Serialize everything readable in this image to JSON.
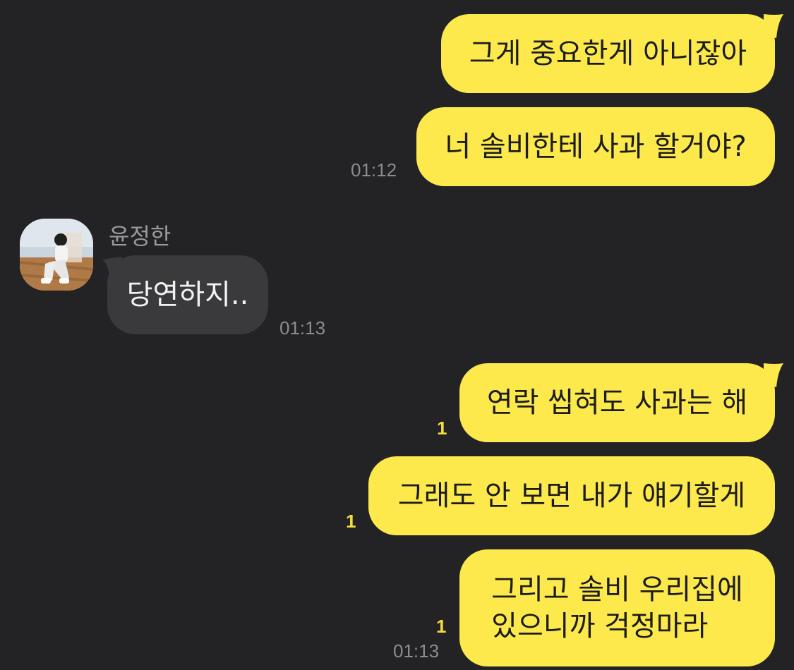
{
  "messages": [
    {
      "side": "me",
      "text": "그게 중요한게 아니잖아"
    },
    {
      "side": "me",
      "text": "너 솔비한테 사과 할거야?",
      "time": "01:12"
    },
    {
      "side": "other",
      "sender": "윤정한",
      "text": "당연하지..",
      "time": "01:13"
    },
    {
      "side": "me",
      "text": "연락 씹혀도 사과는 해",
      "unread": "1"
    },
    {
      "side": "me",
      "text": "그래도 안 보면 내가 얘기할게",
      "unread": "1"
    },
    {
      "side": "me",
      "text": "그리고 솔비 우리집에\n있으니까 걱정마라",
      "unread": "1",
      "time": "01:13"
    }
  ],
  "colors": {
    "background": "#232325",
    "my_bubble": "#fee94c",
    "their_bubble": "#3a3a3c",
    "unread_count": "#f3de3a",
    "timestamp": "#8c8c90"
  },
  "avatar": {
    "icon": "profile-photo"
  }
}
